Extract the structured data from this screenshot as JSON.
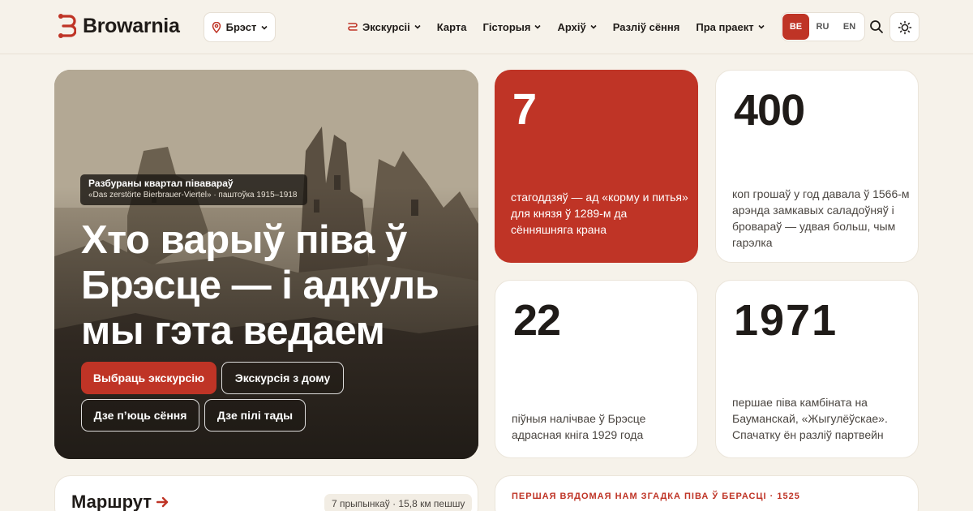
{
  "header": {
    "logo_text": "Browarnia",
    "city": "Брэст",
    "nav": [
      {
        "label": "Экскурсіі"
      },
      {
        "label": "Карта"
      },
      {
        "label": "Гісторыя"
      },
      {
        "label": "Архіў"
      },
      {
        "label": "Разліў сёння"
      },
      {
        "label": "Пра праект"
      }
    ],
    "languages": [
      "BE",
      "RU",
      "EN"
    ],
    "active_language": "BE"
  },
  "hero": {
    "caption_title": "Разбураны квартал піваварaў",
    "caption_sub": "«Das zerstörte Bierbrauer-Viertel» · паштоўка 1915–1918",
    "title": "Хто варыў піва ў Брэсце — і адкуль мы гэта ведаем",
    "buttons": {
      "primary": "Выбраць экскурсію",
      "home": "Экскурсія з дому",
      "today": "Дзе п’юць сёння",
      "past": "Дзе пілі тады"
    }
  },
  "stats": [
    {
      "number": "7",
      "text": "стагоддзяў — ад «корму и питья» для князя ў 1289-м да сённяшняга крана"
    },
    {
      "number": "400",
      "text": "коп грошаў у год давала ў 1566-м арэнда замкавых саладоўняў і бровараў — удвая больш, чым гарэлка"
    },
    {
      "number": "22",
      "text": "піўныя налічвае ў Брэсце адрасная кніга 1929 года"
    },
    {
      "number": "1971",
      "text": "першае піва камбіната на Бауманскай, «Жыгулёўскае». Спачатку ён разліў партвейн"
    }
  ],
  "route": {
    "title": "Маршрут",
    "meta": "7 прыпынкаў · 15,8 км пешшу"
  },
  "mention": {
    "label": "ПЕРШАЯ ВЯДОМАЯ НАМ ЗГАДКА ПІВА Ў БЕРАСЦІ · 1525"
  },
  "colors": {
    "accent": "#bf3426",
    "background": "#f6f2ea"
  }
}
